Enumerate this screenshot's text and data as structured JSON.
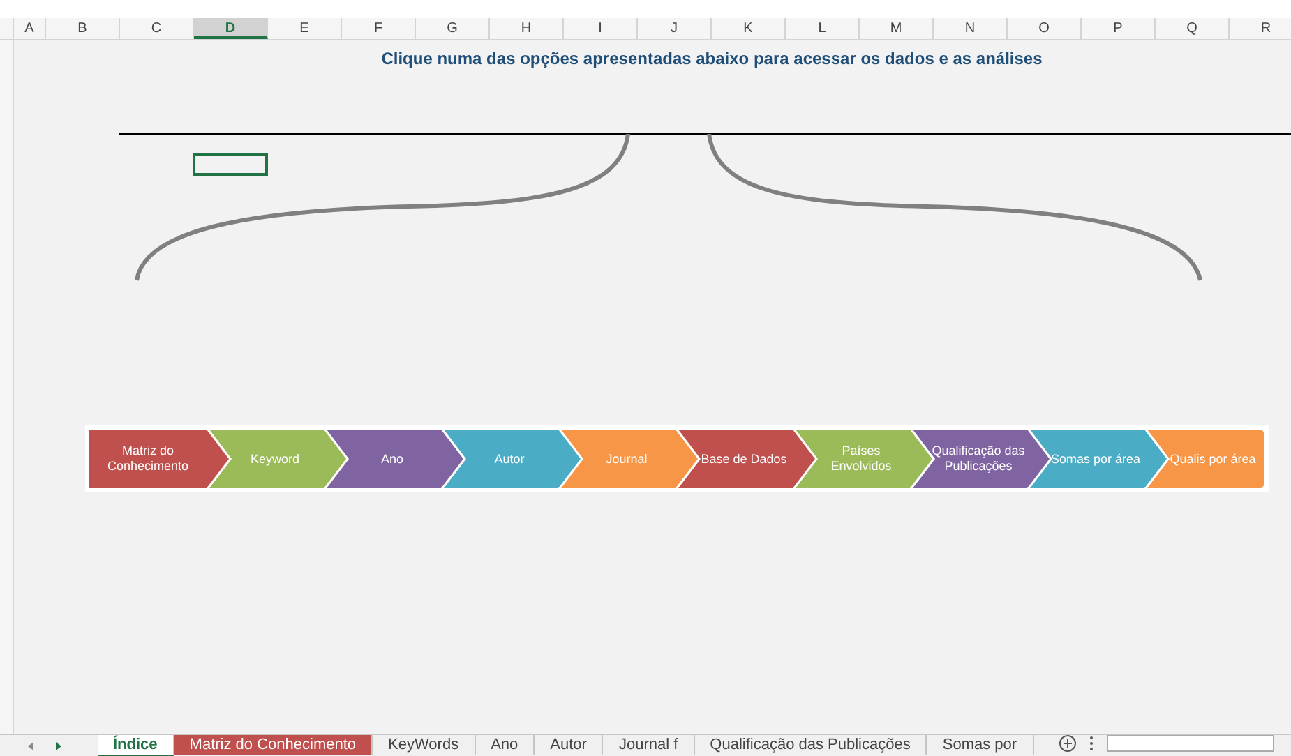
{
  "columns": [
    {
      "label": "A",
      "selected": false
    },
    {
      "label": "B",
      "selected": false
    },
    {
      "label": "C",
      "selected": false
    },
    {
      "label": "D",
      "selected": true
    },
    {
      "label": "E",
      "selected": false
    },
    {
      "label": "F",
      "selected": false
    },
    {
      "label": "G",
      "selected": false
    },
    {
      "label": "H",
      "selected": false
    },
    {
      "label": "I",
      "selected": false
    },
    {
      "label": "J",
      "selected": false
    },
    {
      "label": "K",
      "selected": false
    },
    {
      "label": "L",
      "selected": false
    },
    {
      "label": "M",
      "selected": false
    },
    {
      "label": "N",
      "selected": false
    },
    {
      "label": "O",
      "selected": false
    },
    {
      "label": "P",
      "selected": false
    },
    {
      "label": "Q",
      "selected": false
    },
    {
      "label": "R",
      "selected": false
    }
  ],
  "title": "Clique numa das opções apresentadas abaixo para acessar os dados e as análises",
  "steps": [
    {
      "label": "Matriz do Conhecimento",
      "color": "#c0504d"
    },
    {
      "label": "Keyword",
      "color": "#9bbb59"
    },
    {
      "label": "Ano",
      "color": "#8064a2"
    },
    {
      "label": "Autor",
      "color": "#4bacc6"
    },
    {
      "label": "Journal",
      "color": "#f79646"
    },
    {
      "label": "Base de Dados",
      "color": "#c0504d"
    },
    {
      "label": "Países Envolvidos",
      "color": "#9bbb59"
    },
    {
      "label": "Qualificação das Publicações",
      "color": "#8064a2"
    },
    {
      "label": "Somas por área",
      "color": "#4bacc6"
    },
    {
      "label": "Qualis por área",
      "color": "#f79646"
    }
  ],
  "sheet_tabs": [
    {
      "label": "Índice",
      "selected": true
    },
    {
      "label": "Matriz do Conhecimento",
      "selected": false,
      "color": "#c0504d"
    },
    {
      "label": "KeyWords",
      "selected": false
    },
    {
      "label": "Ano",
      "selected": false
    },
    {
      "label": "Autor",
      "selected": false
    },
    {
      "label": "Journal f",
      "selected": false
    },
    {
      "label": "Qualificação das Publicações",
      "selected": false
    },
    {
      "label": "Somas por",
      "selected": false
    }
  ]
}
